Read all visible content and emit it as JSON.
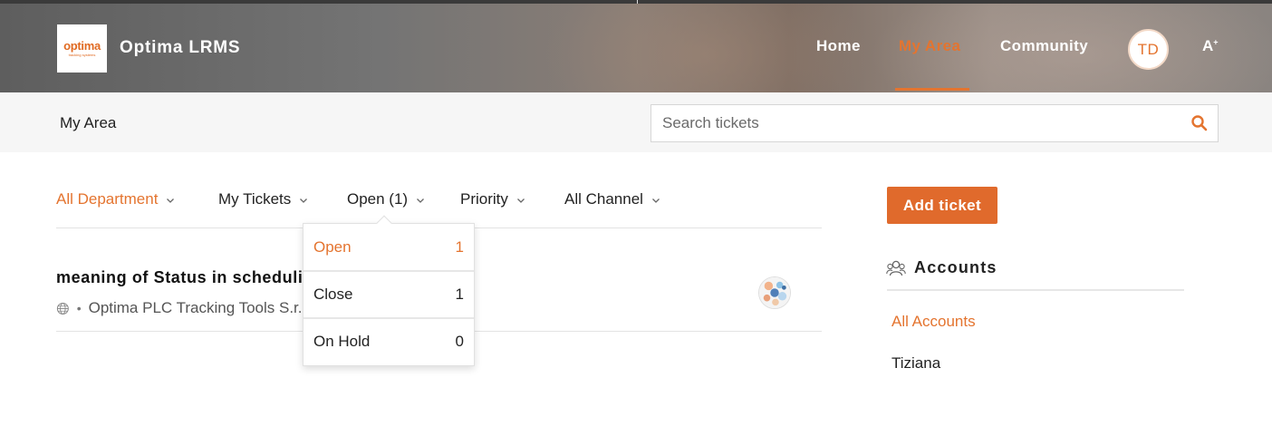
{
  "header": {
    "logo_word": "optima",
    "logo_tagline": "tracking systems",
    "brand": "Optima LRMS",
    "nav": [
      {
        "label": "Home"
      },
      {
        "label": "My Area"
      },
      {
        "label": "Community"
      }
    ],
    "active_nav": "My Area",
    "avatar_initials": "TD",
    "font_size_label": "A"
  },
  "subheader": {
    "title": "My Area",
    "search_placeholder": "Search tickets"
  },
  "filters": [
    {
      "label": "All Department",
      "active": true
    },
    {
      "label": "My Tickets",
      "active": false
    },
    {
      "label": "Open (1)",
      "active": false
    },
    {
      "label": "Priority",
      "active": false
    },
    {
      "label": "All Channel",
      "active": false
    }
  ],
  "status_dropdown": {
    "items": [
      {
        "label": "Open",
        "count": "1",
        "active": true
      },
      {
        "label": "Close",
        "count": "1",
        "active": false
      },
      {
        "label": "On Hold",
        "count": "0",
        "active": false
      }
    ]
  },
  "ticket": {
    "title": "meaning of Status in scheduling",
    "bullet": "•",
    "meta": "Optima PLC Tracking Tools S.r.l."
  },
  "sidebar": {
    "add_ticket_label": "Add ticket",
    "accounts_title": "Accounts",
    "accounts": [
      {
        "label": "All Accounts",
        "active": true
      },
      {
        "label": "Tiziana",
        "active": false
      }
    ]
  },
  "colors": {
    "accent": "#e4742f",
    "button": "#e06a2c"
  }
}
